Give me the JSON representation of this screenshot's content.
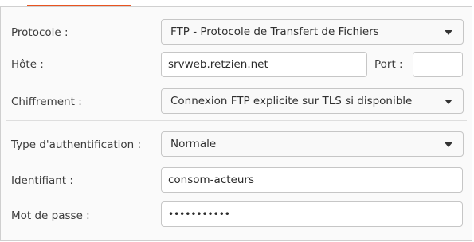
{
  "form": {
    "protocol": {
      "label": "Protocole :",
      "value": "FTP - Protocole de Transfert de Fichiers"
    },
    "host": {
      "label": "Hôte :",
      "value": "srvweb.retzien.net"
    },
    "port": {
      "label": "Port :",
      "value": ""
    },
    "encryption": {
      "label": "Chiffrement :",
      "value": "Connexion FTP explicite sur TLS si disponible"
    },
    "auth_type": {
      "label": "Type d'authentification :",
      "value": "Normale"
    },
    "username": {
      "label": "Identifiant :",
      "value": "consom-acteurs"
    },
    "password": {
      "label": "Mot de passe :",
      "value": "•••••••••••"
    }
  },
  "colors": {
    "accent": "#e95420"
  }
}
